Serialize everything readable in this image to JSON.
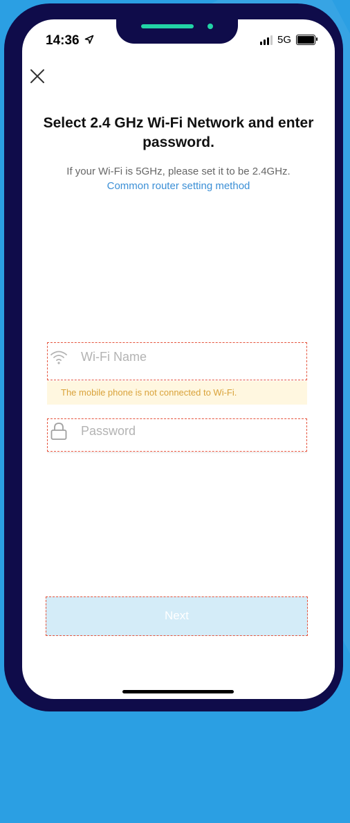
{
  "colors": {
    "background": "#2b9fe3",
    "phone_frame": "#0f0c4a",
    "accent": "#22d3a6",
    "link": "#3b8fd6",
    "warning_text": "#d9a23a",
    "warning_bg": "#fff7e0",
    "button_bg": "#d4ecf8",
    "highlight": "#e5533c"
  },
  "status_bar": {
    "time": "14:36",
    "network": "5G",
    "icons": [
      "location-arrow-icon",
      "signal-icon",
      "battery-icon"
    ]
  },
  "header": {
    "close_icon": "close-icon"
  },
  "main": {
    "title": "Select 2.4 GHz Wi-Fi Network and enter password.",
    "subtitle": "If your Wi-Fi is 5GHz, please set it to be 2.4GHz.",
    "router_link": "Common router setting method"
  },
  "form": {
    "wifi": {
      "placeholder": "Wi-Fi Name",
      "value": "",
      "icon": "wifi-icon"
    },
    "warning": "The mobile phone is not connected to Wi-Fi.",
    "password": {
      "placeholder": "Password",
      "value": "",
      "icon": "lock-icon"
    },
    "next_label": "Next"
  }
}
